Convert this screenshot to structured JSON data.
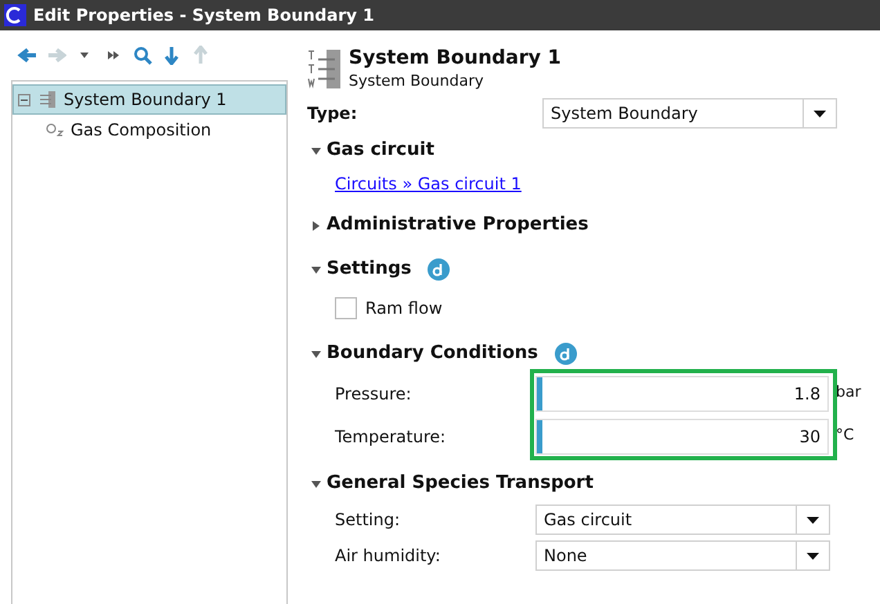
{
  "window": {
    "title": "Edit Properties - System Boundary 1"
  },
  "toolbar": [
    {
      "kind": "back",
      "disabled": false
    },
    {
      "kind": "forward",
      "disabled": true
    },
    {
      "kind": "caret",
      "disabled": false
    },
    {
      "kind": "skip",
      "disabled": false
    },
    {
      "kind": "search",
      "disabled": false
    },
    {
      "kind": "down",
      "disabled": false
    },
    {
      "kind": "up",
      "disabled": true
    }
  ],
  "tree": [
    {
      "label": "System Boundary 1",
      "kind": "boundary",
      "selected": true,
      "expanded": true,
      "children": [
        {
          "label": "Gas Composition",
          "kind": "gas",
          "selected": false
        }
      ]
    }
  ],
  "header": {
    "title": "System Boundary 1",
    "subtitle": "System Boundary"
  },
  "type_field": {
    "label": "Type:",
    "value": "System Boundary"
  },
  "sections": [
    {
      "title": "Gas circuit",
      "expanded": true,
      "info_badge": false,
      "highlighted": false,
      "rows": [
        {
          "kind": "link",
          "text": "Circuits » Gas circuit 1"
        }
      ]
    },
    {
      "title": "Administrative Properties",
      "expanded": false,
      "info_badge": false,
      "highlighted": false
    },
    {
      "title": "Settings",
      "expanded": true,
      "info_badge": true,
      "highlighted": false,
      "rows": [
        {
          "kind": "checkbox",
          "label": "Ram flow",
          "checked": false
        }
      ]
    },
    {
      "title": "Boundary Conditions",
      "expanded": true,
      "info_badge": true,
      "highlighted": true,
      "rows": [
        {
          "kind": "number",
          "label": "Pressure:",
          "value": "1.8",
          "unit": "bar"
        },
        {
          "kind": "number",
          "label": "Temperature:",
          "value": "30",
          "unit": "°C"
        }
      ]
    },
    {
      "title": "General Species Transport",
      "expanded": true,
      "info_badge": false,
      "highlighted": false,
      "rows": [
        {
          "kind": "select",
          "label": "Setting:",
          "value": "Gas circuit"
        },
        {
          "kind": "select",
          "label": "Air humidity:",
          "value": "None"
        }
      ]
    }
  ]
}
